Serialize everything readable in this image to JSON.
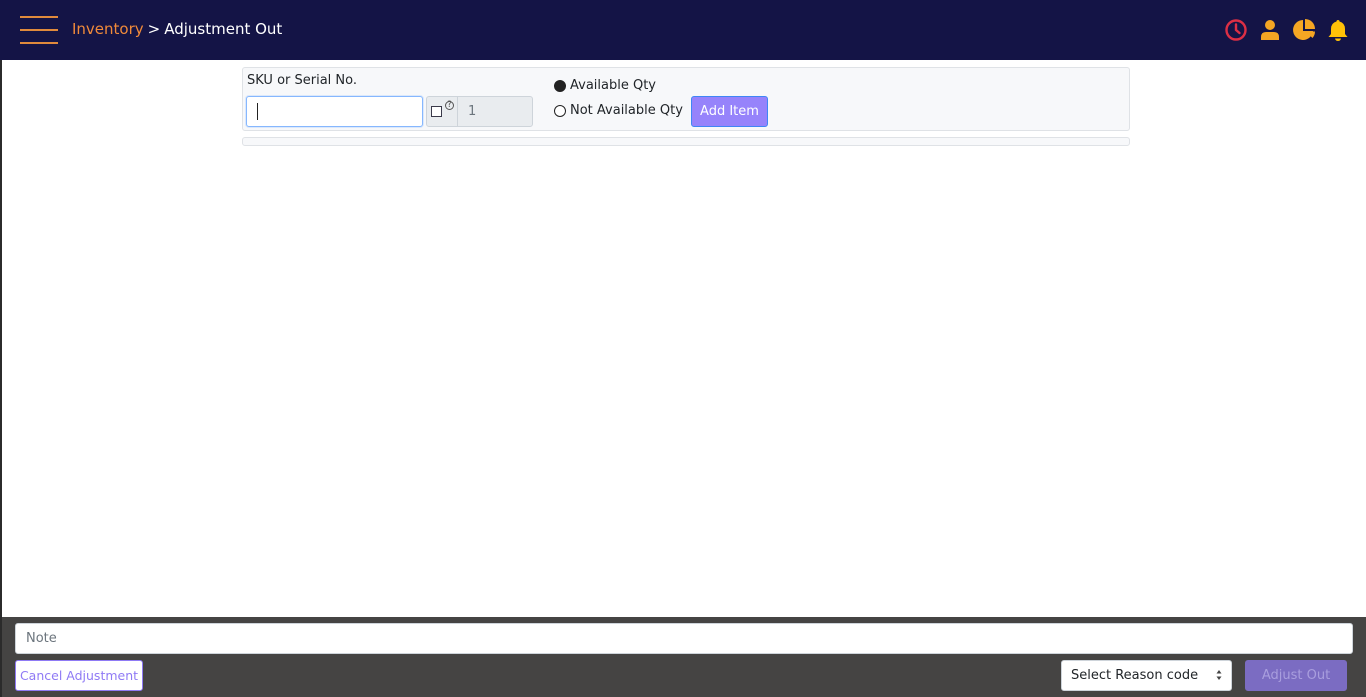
{
  "header": {
    "breadcrumb": {
      "parent": "Inventory",
      "separator": ">",
      "current": "Adjustment Out"
    },
    "icons": [
      "history-clock-icon",
      "user-icon",
      "pie-chart-icon",
      "bell-icon"
    ],
    "colors": {
      "background": "#141446",
      "accent": "#f08a3a",
      "clock": "#dc2f45",
      "icon_yellow": "#f5a623",
      "bell": "#ffc107"
    }
  },
  "entry": {
    "sku_label": "SKU or Serial No.",
    "sku_value": "",
    "qty_value": "1",
    "qty_checkbox_checked": false,
    "radio_options": [
      {
        "label": "Available Qty",
        "checked": true
      },
      {
        "label": "Not Available Qty",
        "checked": false
      }
    ],
    "add_item_label": "Add Item"
  },
  "footer": {
    "note_placeholder": "Note",
    "cancel_label": "Cancel Adjustment",
    "reason_select_value": "Select Reason code",
    "adjust_out_label": "Adjust Out"
  }
}
